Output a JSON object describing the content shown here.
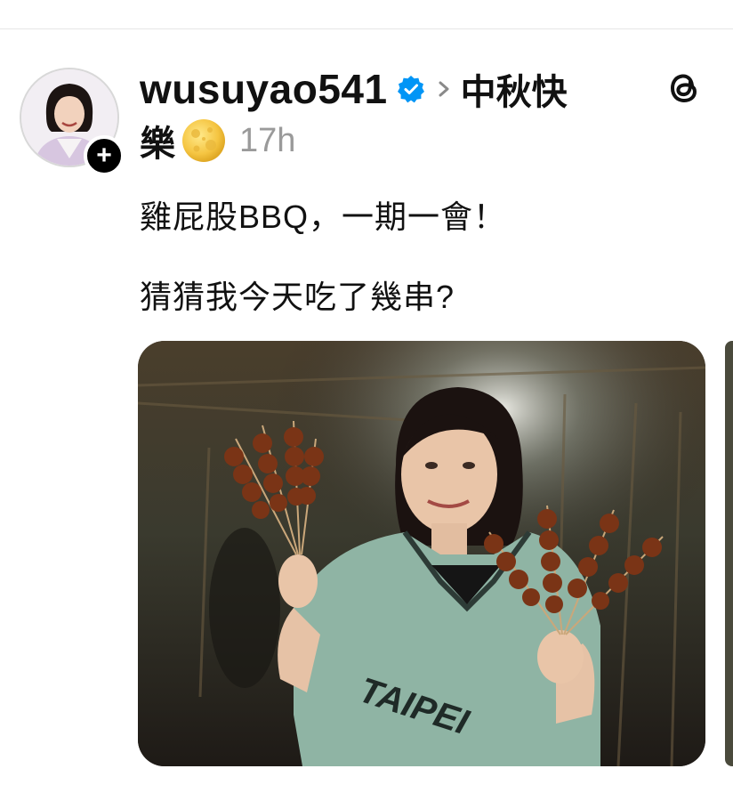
{
  "post": {
    "username": "wusuyao541",
    "topic_line1": "中秋快",
    "topic_line2": "樂",
    "time_ago": "17h",
    "text_line1": "雞屁股BBQ，一期一會！",
    "text_line2": "猜猜我今天吃了幾串?",
    "follow_symbol": "+"
  },
  "icons": {
    "verified": "verified-badge-icon",
    "chevron": "chevron-right-icon",
    "moon": "full-moon-emoji",
    "threads": "threads-logo-icon"
  },
  "colors": {
    "verified_blue": "#0095f6",
    "time_gray": "#9a9a9a"
  }
}
